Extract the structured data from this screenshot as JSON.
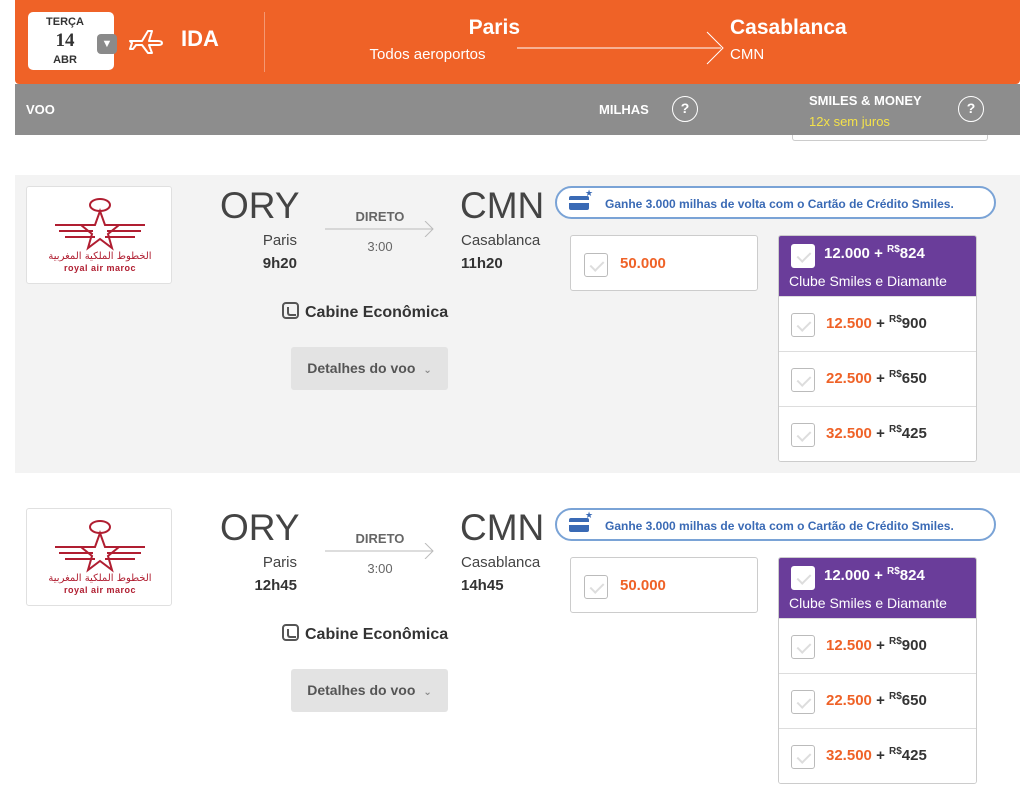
{
  "header": {
    "date": {
      "weekday": "TERÇA",
      "day": "14",
      "month": "ABR"
    },
    "direction": "IDA",
    "origin": {
      "city": "Paris",
      "sub": "Todos aeroportos"
    },
    "destination": {
      "city": "Casablanca",
      "sub": "CMN"
    }
  },
  "columns": {
    "flight": "VOO",
    "miles": "MILHAS",
    "smiles_money": "SMILES & MONEY",
    "smiles_money_sub": "12x sem juros",
    "help": "?"
  },
  "promo_text": "Ganhe 3.000 milhas de volta com o Cartão de Crédito Smiles.",
  "airline": {
    "arabic": "الخطوط الملكية المغربية",
    "name": "royal air maroc"
  },
  "flights": [
    {
      "orig_code": "ORY",
      "orig_city": "Paris",
      "dep": "9h20",
      "dest_code": "CMN",
      "dest_city": "Casablanca",
      "arr": "11h20",
      "type": "DIRETO",
      "duration": "3:00",
      "cabin": "Cabine Econômica",
      "details": "Detalhes do voo",
      "miles": "50.000",
      "club_label": "Clube Smiles e Diamante",
      "options": [
        {
          "miles": "12.000",
          "plus": "+",
          "currency": "R$",
          "money": "824"
        },
        {
          "miles": "12.500",
          "plus": "+",
          "currency": "R$",
          "money": "900"
        },
        {
          "miles": "22.500",
          "plus": "+",
          "currency": "R$",
          "money": "650"
        },
        {
          "miles": "32.500",
          "plus": "+",
          "currency": "R$",
          "money": "425"
        }
      ]
    },
    {
      "orig_code": "ORY",
      "orig_city": "Paris",
      "dep": "12h45",
      "dest_code": "CMN",
      "dest_city": "Casablanca",
      "arr": "14h45",
      "type": "DIRETO",
      "duration": "3:00",
      "cabin": "Cabine Econômica",
      "details": "Detalhes do voo",
      "miles": "50.000",
      "club_label": "Clube Smiles e Diamante",
      "options": [
        {
          "miles": "12.000",
          "plus": "+",
          "currency": "R$",
          "money": "824"
        },
        {
          "miles": "12.500",
          "plus": "+",
          "currency": "R$",
          "money": "900"
        },
        {
          "miles": "22.500",
          "plus": "+",
          "currency": "R$",
          "money": "650"
        },
        {
          "miles": "32.500",
          "plus": "+",
          "currency": "R$",
          "money": "425"
        }
      ]
    }
  ],
  "colors": {
    "brand_orange": "#ef6227",
    "header_grey": "#8d8d8d",
    "club_purple": "#6a3d9a",
    "promo_blue": "#3a6ab5",
    "airline_red": "#b01e31"
  }
}
